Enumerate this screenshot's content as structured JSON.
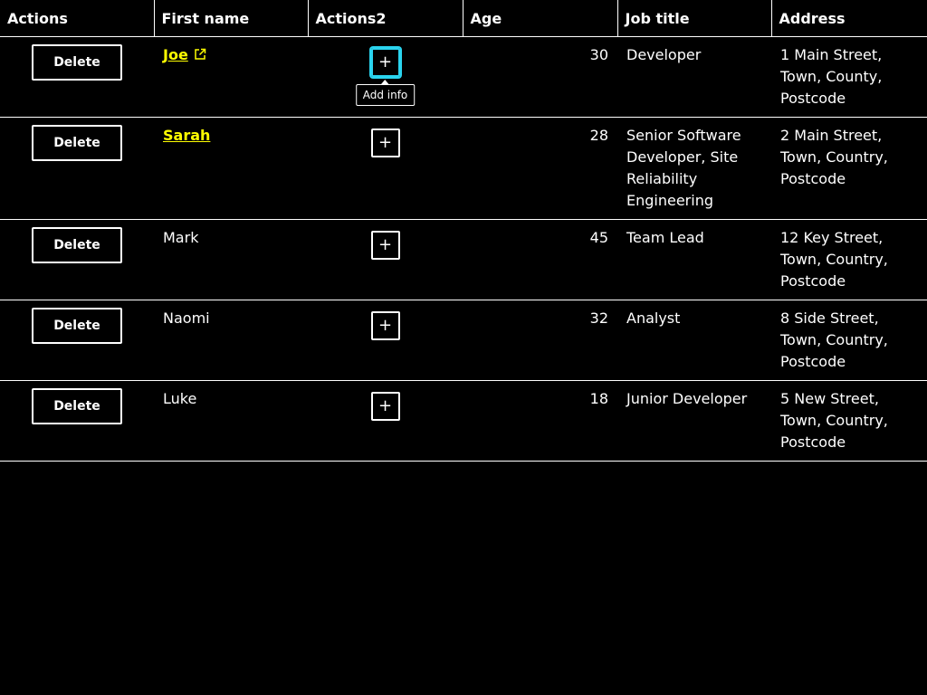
{
  "columns": {
    "actions": "Actions",
    "first_name": "First name",
    "actions2": "Actions2",
    "age": "Age",
    "job_title": "Job title",
    "address": "Address"
  },
  "delete_label": "Delete",
  "add_label": "+",
  "tooltip_text": "Add info",
  "colors": {
    "background": "#000000",
    "text": "#ffffff",
    "link": "#ffff00",
    "focus": "#2ad4ef"
  },
  "rows": [
    {
      "first_name": "Joe",
      "age": "30",
      "job_title": "Developer",
      "address": "1 Main Street, Town, County, Postcode",
      "link": true,
      "external_icon": "external-link-icon"
    },
    {
      "first_name": "Sarah",
      "age": "28",
      "job_title": "Senior Software Developer, Site Reliability Engineering",
      "address": "2 Main Street, Town, Country, Postcode",
      "link": true
    },
    {
      "first_name": "Mark",
      "age": "45",
      "job_title": "Team Lead",
      "address": "12 Key Street, Town, Country, Postcode"
    },
    {
      "first_name": "Naomi",
      "age": "32",
      "job_title": "Analyst",
      "address": "8 Side Street, Town, Country, Postcode"
    },
    {
      "first_name": "Luke",
      "age": "18",
      "job_title": "Junior Developer",
      "address": "5 New Street, Town, Country, Postcode"
    }
  ]
}
